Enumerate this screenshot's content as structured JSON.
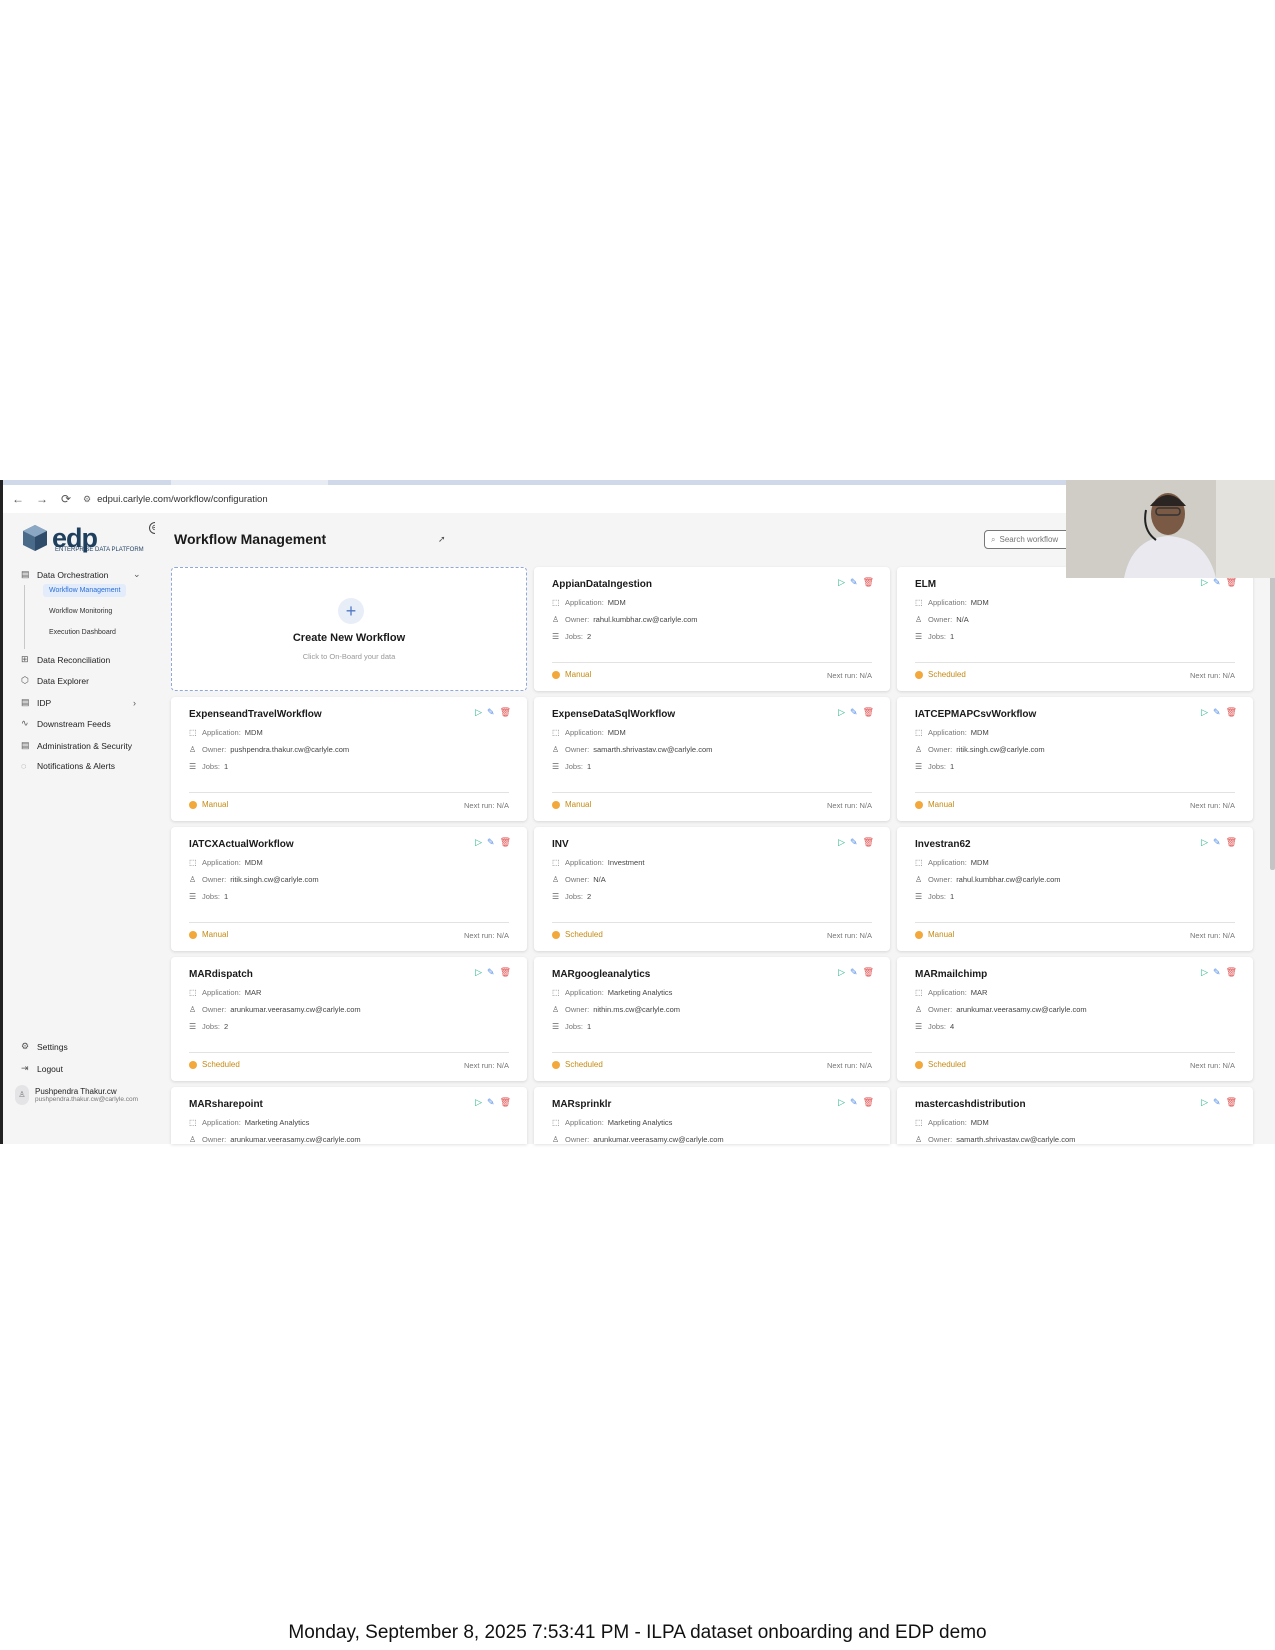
{
  "browser": {
    "url": "edpui.carlyle.com/workflow/configuration",
    "back": "←",
    "forward": "→",
    "reload": "⟳",
    "site_icon": "⚙"
  },
  "logo": {
    "word": "edp",
    "tagline": "ENTERPRISE DATA PLATFORM"
  },
  "sidebar": {
    "collapse": "⊖",
    "items": [
      {
        "label": "Data Orchestration",
        "icon": "calendar-icon"
      },
      {
        "label": "Data Reconciliation",
        "icon": "grid-icon"
      },
      {
        "label": "Data Explorer",
        "icon": "cube-icon"
      },
      {
        "label": "IDP",
        "icon": "calendar-icon"
      },
      {
        "label": "Downstream Feeds",
        "icon": "trend-icon"
      },
      {
        "label": "Administration & Security",
        "icon": "calendar-icon"
      },
      {
        "label": "Notifications & Alerts",
        "icon": "bell-icon"
      }
    ],
    "sub_items": [
      "Workflow Management",
      "Workflow Monitoring",
      "Execution Dashboard"
    ],
    "settings": "Settings",
    "logout": "Logout",
    "user": {
      "name": "Pushpendra Thakur.cw",
      "email": "pushpendra.thakur.cw@carlyle.com"
    }
  },
  "main": {
    "title": "Workflow Management",
    "search_placeholder": "Search workflow"
  },
  "create_card": {
    "plus": "+",
    "title": "Create New Workflow",
    "subtitle": "Click to On-Board your data"
  },
  "labels": {
    "application": "Application:",
    "owner": "Owner:",
    "jobs": "Jobs:",
    "next_run": "Next run: N/A"
  },
  "workflows": [
    {
      "name": "AppianDataIngestion",
      "application": "MDM",
      "owner": "rahul.kumbhar.cw@carlyle.com",
      "jobs": "2",
      "status": "Manual"
    },
    {
      "name": "ELM",
      "application": "MDM",
      "owner": "N/A",
      "jobs": "1",
      "status": "Scheduled"
    },
    {
      "name": "ExpenseandTravelWorkflow",
      "application": "MDM",
      "owner": "pushpendra.thakur.cw@carlyle.com",
      "jobs": "1",
      "status": "Manual"
    },
    {
      "name": "ExpenseDataSqlWorkflow",
      "application": "MDM",
      "owner": "samarth.shrivastav.cw@carlyle.com",
      "jobs": "1",
      "status": "Manual"
    },
    {
      "name": "IATCEPMAPCsvWorkflow",
      "application": "MDM",
      "owner": "ritik.singh.cw@carlyle.com",
      "jobs": "1",
      "status": "Manual"
    },
    {
      "name": "IATCXActualWorkflow",
      "application": "MDM",
      "owner": "ritik.singh.cw@carlyle.com",
      "jobs": "1",
      "status": "Manual"
    },
    {
      "name": "INV",
      "application": "Investment",
      "owner": "N/A",
      "jobs": "2",
      "status": "Scheduled"
    },
    {
      "name": "Investran62",
      "application": "MDM",
      "owner": "rahul.kumbhar.cw@carlyle.com",
      "jobs": "1",
      "status": "Manual"
    },
    {
      "name": "MARdispatch",
      "application": "MAR",
      "owner": "arunkumar.veerasamy.cw@carlyle.com",
      "jobs": "2",
      "status": "Scheduled"
    },
    {
      "name": "MARgoogleanalytics",
      "application": "Marketing Analytics",
      "owner": "nithin.ms.cw@carlyle.com",
      "jobs": "1",
      "status": "Scheduled"
    },
    {
      "name": "MARmailchimp",
      "application": "MAR",
      "owner": "arunkumar.veerasamy.cw@carlyle.com",
      "jobs": "4",
      "status": "Scheduled"
    },
    {
      "name": "MARsharepoint",
      "application": "Marketing Analytics",
      "owner": "arunkumar.veerasamy.cw@carlyle.com",
      "jobs": "",
      "status": ""
    },
    {
      "name": "MARsprinklr",
      "application": "Marketing Analytics",
      "owner": "arunkumar.veerasamy.cw@carlyle.com",
      "jobs": "",
      "status": ""
    },
    {
      "name": "mastercashdistribution",
      "application": "MDM",
      "owner": "samarth.shrivastav.cw@carlyle.com",
      "jobs": "",
      "status": ""
    }
  ],
  "caption": "Monday, September 8, 2025 7:53:41 PM - ILPA dataset onboarding and EDP demo"
}
